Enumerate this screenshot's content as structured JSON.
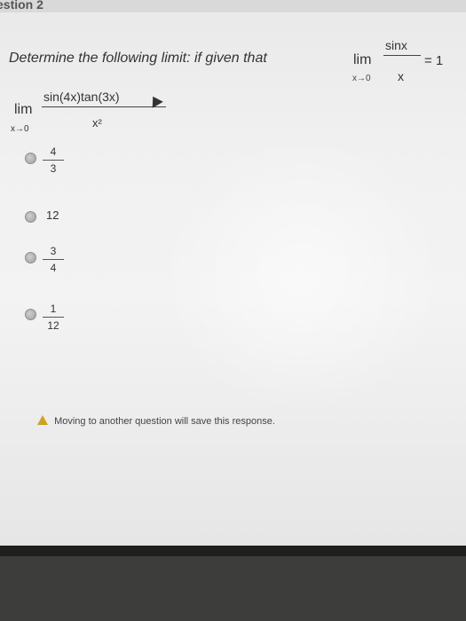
{
  "question": {
    "title": "estion 2",
    "prompt": "Determine the following limit: if given that",
    "given": {
      "lim": "lim",
      "sub": "x→0",
      "numerator": "sinx",
      "denominator": "x",
      "equals": "= 1"
    },
    "expression": {
      "lim": "lim",
      "sub": "x→0",
      "numerator": "sin(4x)tan(3x)",
      "denominator": "x²"
    }
  },
  "options": [
    {
      "numerator": "4",
      "denominator": "3"
    },
    {
      "value": "12"
    },
    {
      "numerator": "3",
      "denominator": "4"
    },
    {
      "numerator": "1",
      "denominator": "12"
    }
  ],
  "warning": "Moving to another question will save this response.",
  "icons": {
    "warning": "warning-icon",
    "cursor": "mouse-cursor-icon"
  },
  "colors": {
    "warning": "#d4a017",
    "background": "#f1f1f1"
  }
}
